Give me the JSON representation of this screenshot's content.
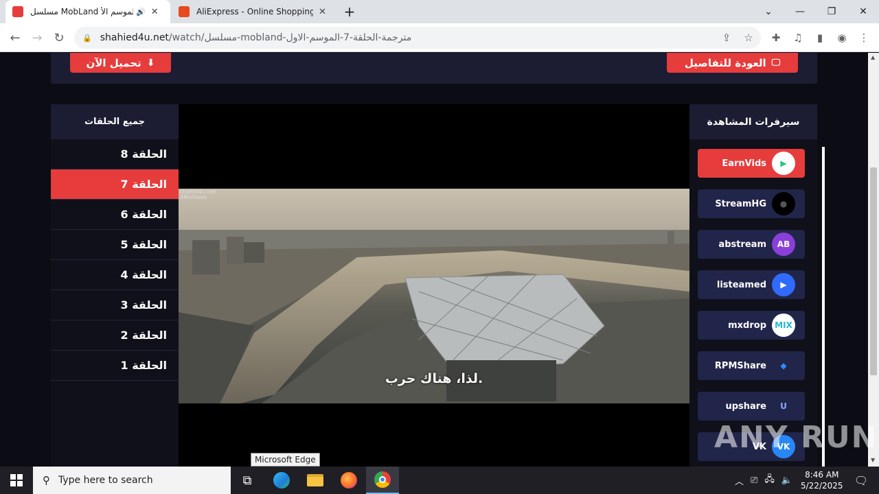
{
  "browser": {
    "tabs": [
      {
        "title": "مسلسل MobLand الموسم الأ",
        "favicon_color": "#e63c3c",
        "active": true
      },
      {
        "title": "AliExpress - Online Shopping für",
        "favicon_color": "#e8491d",
        "active": false
      }
    ],
    "new_tab": "+",
    "url_host": "shahied4u.net",
    "url_path": "/watch/مسلسل-mobland-مترجمة-الحلقة-7-الموسم-الاول",
    "window_controls": {
      "minimize": "—",
      "restore": "❐",
      "close": "✕",
      "tablist": "⌄"
    }
  },
  "page": {
    "back_to_details": "العودة للتفاصيل",
    "download_now": "تحميل الآن",
    "episodes_header": "جميع الحلقات",
    "episodes": [
      {
        "label": "الحلقة 8",
        "active": false
      },
      {
        "label": "الحلقة 7",
        "active": true
      },
      {
        "label": "الحلقة 6",
        "active": false
      },
      {
        "label": "الحلقة 5",
        "active": false
      },
      {
        "label": "الحلقة 4",
        "active": false
      },
      {
        "label": "الحلقة 3",
        "active": false
      },
      {
        "label": "الحلقة 2",
        "active": false
      },
      {
        "label": "الحلقة 1",
        "active": false
      }
    ],
    "servers_header": "سيرفرات المشاهدة",
    "servers": [
      {
        "name": "EarnVids",
        "active": true,
        "logo_text": "▶",
        "logo_bg": "#ffffff",
        "logo_fg": "#2bc48a"
      },
      {
        "name": "StreamHG",
        "active": false,
        "logo_text": "●",
        "logo_bg": "#000000",
        "logo_fg": "#555555"
      },
      {
        "name": "abstream",
        "active": false,
        "logo_text": "AB",
        "logo_bg": "#8a3fd8",
        "logo_fg": "#ffffff"
      },
      {
        "name": "listeamed",
        "active": false,
        "logo_text": "▶",
        "logo_bg": "#2f6bff",
        "logo_fg": "#ffffff"
      },
      {
        "name": "mxdrop",
        "active": false,
        "logo_text": "MIX",
        "logo_bg": "#ffffff",
        "logo_fg": "#27b6d6"
      },
      {
        "name": "RPMShare",
        "active": false,
        "logo_text": "◆",
        "logo_bg": "#22254a",
        "logo_fg": "#2f8cff"
      },
      {
        "name": "upshare",
        "active": false,
        "logo_text": "U",
        "logo_bg": "#22254a",
        "logo_fg": "#7fa9ff"
      },
      {
        "name": "VK",
        "active": false,
        "logo_text": "VK",
        "logo_bg": "#2787f5",
        "logo_fg": "#ffffff"
      }
    ],
    "video": {
      "subtitle": "لذا، هناك حرب.",
      "watermark_line1": "shahid4u.net",
      "watermark_line2": "4MolSeed"
    }
  },
  "taskbar": {
    "search_placeholder": "Type here to search",
    "tooltip": "Microsoft Edge",
    "time": "8:46 AM",
    "date": "5/22/2025"
  },
  "overlay": {
    "watermark": "ANY RUN"
  }
}
